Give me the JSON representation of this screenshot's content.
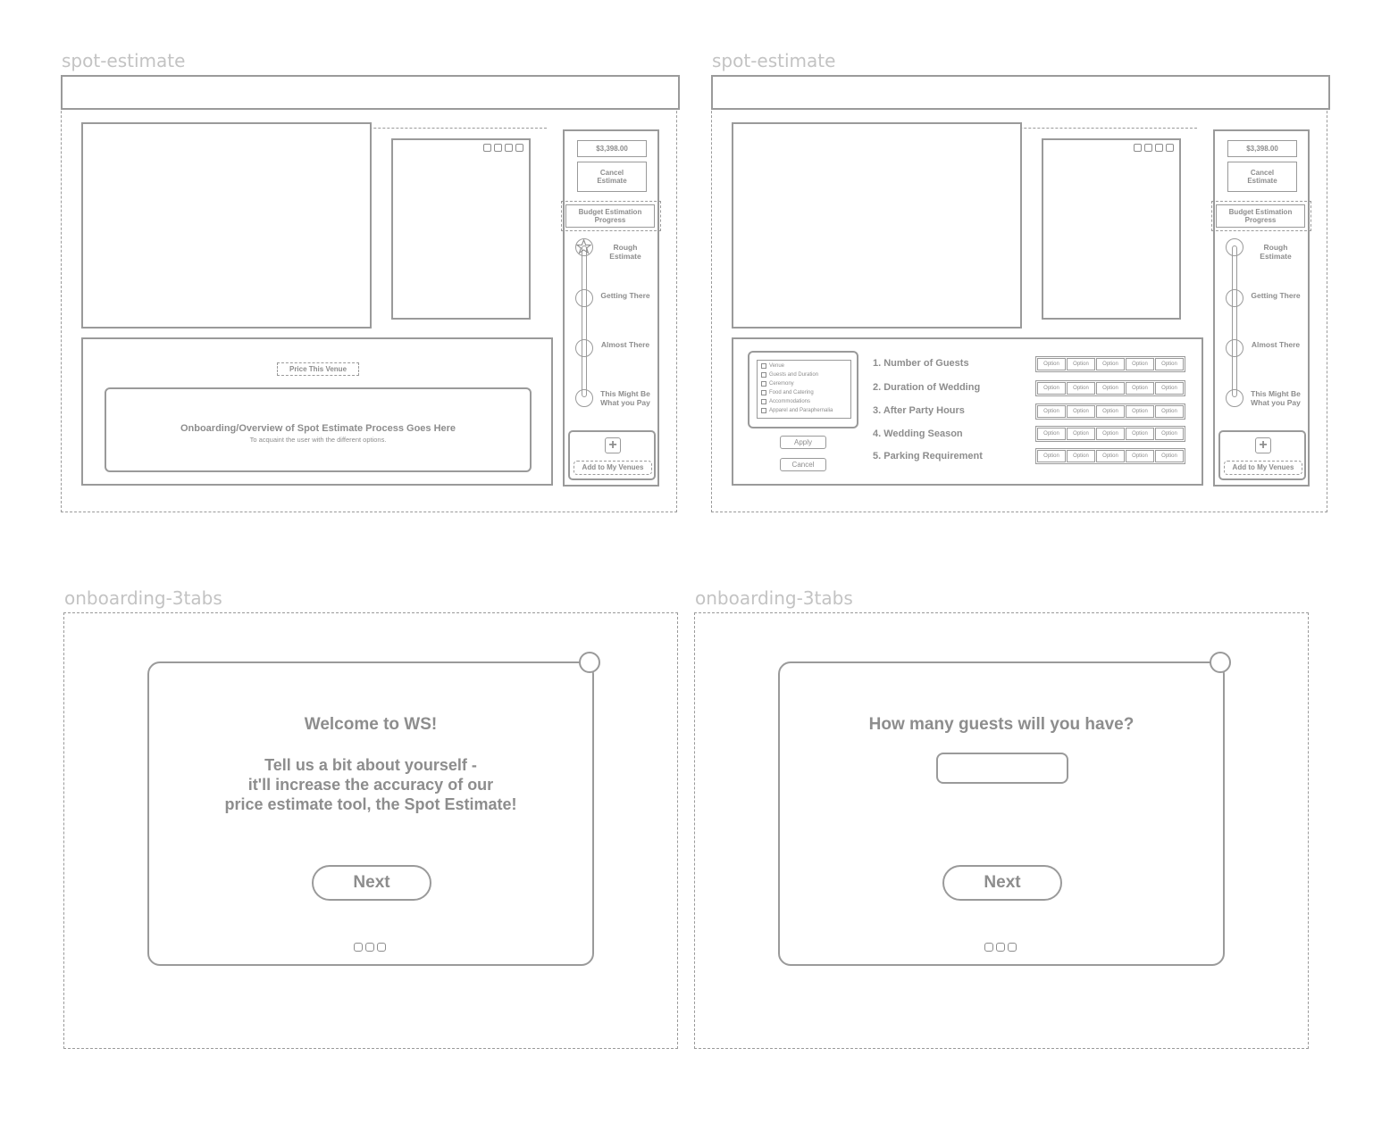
{
  "frames": [
    {
      "label": "spot-estimate"
    },
    {
      "label": "spot-estimate"
    },
    {
      "label": "onboarding-3tabs"
    },
    {
      "label": "onboarding-3tabs"
    }
  ],
  "sidebar": {
    "price": "$3,398.00",
    "cancel_estimate": "Cancel Estimate",
    "progress_title": "Budget Estimation Progress",
    "steps": [
      "Rough Estimate",
      "Getting There",
      "Almost There",
      "This Might Be What you Pay"
    ],
    "add_to_venues": "Add to My Venues"
  },
  "frame1": {
    "price_venue_button": "Price This Venue",
    "onboarding_title": "Onboarding/Overview of Spot Estimate Process Goes Here",
    "onboarding_sub": "To acquaint the user with the different options."
  },
  "frame2": {
    "checklist": [
      "Venue",
      "Guests and Duration",
      "Ceremony",
      "Food and Catering",
      "Accommodations",
      "Apparel and Paraphernalia"
    ],
    "apply": "Apply",
    "cancel": "Cancel",
    "questions": [
      "1. Number of Guests",
      "2. Duration of Wedding",
      "3. After Party Hours",
      "4. Wedding Season",
      "5. Parking Requirement"
    ],
    "option_label": "Option"
  },
  "frame3": {
    "title": "Welcome to WS!",
    "line1": "Tell us a bit about yourself -",
    "line2": "it'll increase the accuracy of our",
    "line3": "price estimate tool, the Spot Estimate!",
    "next": "Next"
  },
  "frame4": {
    "question": "How many guests will you have?",
    "next": "Next"
  },
  "colors": {
    "line": "#9a9a9a",
    "text": "#8d8d8d",
    "label": "#c3c3c3"
  }
}
